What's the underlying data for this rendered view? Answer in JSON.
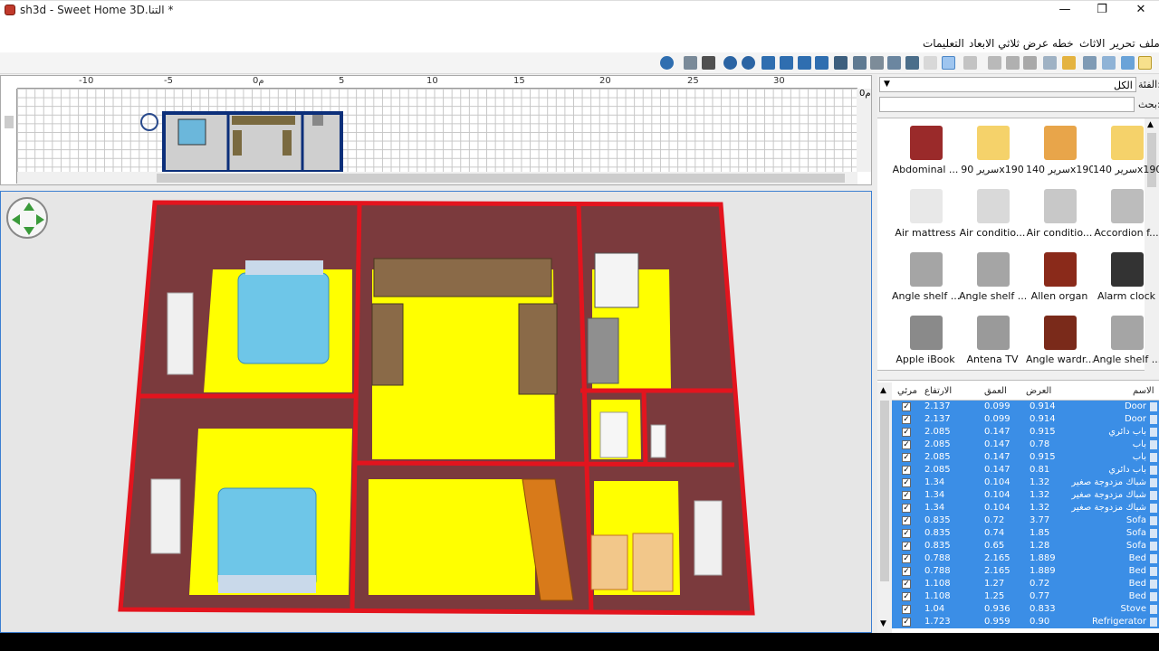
{
  "window": {
    "title": "sh3d - Sweet Home 3D.التنا *",
    "minimize": "—",
    "maximize": "❐",
    "close": "✕"
  },
  "menu": {
    "items": [
      "ملف",
      "تحرير",
      "الاثاث",
      "خطه",
      "عرض ثلاثي الابعاد",
      "التعليمات"
    ]
  },
  "plan": {
    "ruler_labels": [
      "-10",
      "-5",
      "0م",
      "5",
      "10",
      "15",
      "20",
      "25",
      "30"
    ],
    "vertical_label": "0م"
  },
  "catalog": {
    "category_label": "الفئة:",
    "category_value": "الكل",
    "search_label": "بحث:",
    "search_value": "",
    "items": [
      {
        "name": "Abdominal ...",
        "icon": "abdominal-bench-icon"
      },
      {
        "name": "سرير 90x190",
        "icon": "bed-icon"
      },
      {
        "name": "سرير 140x190",
        "icon": "bunk-bed-icon"
      },
      {
        "name": "سرير 140x190",
        "icon": "bed-icon"
      },
      {
        "name": "Air mattress",
        "icon": "air-mattress-icon"
      },
      {
        "name": "Air conditio...",
        "icon": "air-conditioner-icon"
      },
      {
        "name": "Air conditio...",
        "icon": "air-conditioner-outdoor-icon"
      },
      {
        "name": "Accordion f...",
        "icon": "accordion-folding-door-icon"
      },
      {
        "name": "Angle shelf ...",
        "icon": "angle-shelf-icon"
      },
      {
        "name": "Angle shelf ...",
        "icon": "angle-shelf-icon"
      },
      {
        "name": "Allen organ",
        "icon": "organ-icon"
      },
      {
        "name": "Alarm clock",
        "icon": "alarm-clock-icon"
      },
      {
        "name": "Apple iBook",
        "icon": "laptop-icon"
      },
      {
        "name": "Antena TV",
        "icon": "antenna-icon"
      },
      {
        "name": "Angle wardr...",
        "icon": "wardrobe-icon"
      },
      {
        "name": "Angle shelf ...",
        "icon": "angle-shelf-icon"
      }
    ]
  },
  "furniture_table": {
    "headers": {
      "name": "الاسم",
      "width": "العرض",
      "depth": "العمق",
      "height": "الارتفاع",
      "visible": "مرئي"
    },
    "rows": [
      {
        "name": "Door",
        "width": "0.914",
        "depth": "0.099",
        "height": "2.137"
      },
      {
        "name": "Door",
        "width": "0.914",
        "depth": "0.099",
        "height": "2.137"
      },
      {
        "name": "باب دائري",
        "width": "0.915",
        "depth": "0.147",
        "height": "2.085"
      },
      {
        "name": "باب",
        "width": "0.78",
        "depth": "0.147",
        "height": "2.085"
      },
      {
        "name": "باب",
        "width": "0.915",
        "depth": "0.147",
        "height": "2.085"
      },
      {
        "name": "باب دائري",
        "width": "0.81",
        "depth": "0.147",
        "height": "2.085"
      },
      {
        "name": "شباك مزدوجة صغير",
        "width": "1.32",
        "depth": "0.104",
        "height": "1.34"
      },
      {
        "name": "شباك مزدوجة صغير",
        "width": "1.32",
        "depth": "0.104",
        "height": "1.34"
      },
      {
        "name": "شباك مزدوجة صغير",
        "width": "1.32",
        "depth": "0.104",
        "height": "1.34"
      },
      {
        "name": "Sofa",
        "width": "3.77",
        "depth": "0.72",
        "height": "0.835"
      },
      {
        "name": "Sofa",
        "width": "1.85",
        "depth": "0.74",
        "height": "0.835"
      },
      {
        "name": "Sofa",
        "width": "1.28",
        "depth": "0.65",
        "height": "0.835"
      },
      {
        "name": "Bed",
        "width": "1.889",
        "depth": "2.165",
        "height": "0.788"
      },
      {
        "name": "Bed",
        "width": "1.889",
        "depth": "2.165",
        "height": "0.788"
      },
      {
        "name": "Bed",
        "width": "0.72",
        "depth": "1.27",
        "height": "1.108"
      },
      {
        "name": "Bed",
        "width": "0.77",
        "depth": "1.25",
        "height": "1.108"
      },
      {
        "name": "Stove",
        "width": "0.833",
        "depth": "0.936",
        "height": "1.04"
      },
      {
        "name": "Refrigerator",
        "width": "0.90",
        "depth": "0.959",
        "height": "1.723"
      }
    ]
  },
  "colors": {
    "floor": "#ffff00",
    "wall": "#e3141e",
    "wall_inner": "#7a3a3c",
    "bed": "#6ec6e8",
    "selection": "#3b8ee6"
  }
}
